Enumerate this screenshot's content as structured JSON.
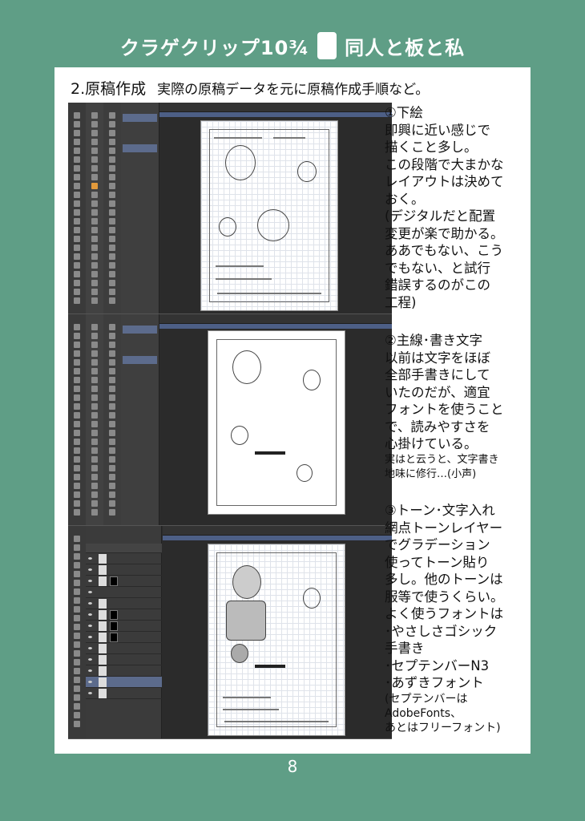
{
  "header": {
    "title_left": "クラゲクリップ10¾",
    "title_right": "同人と板と私",
    "icon": "tablet-icon"
  },
  "section": {
    "title": "2.原稿作成",
    "subtitle": "実際の原稿データを元に原稿作成手順など。"
  },
  "steps": [
    {
      "heading": "①下絵",
      "body": "即興に近い感じで\n描くこと多し。\nこの段階で大まかな\nレイアウトは決めて\nおく。\n(デジタルだと配置\n変更が楽で助かる。\nああでもない、こう\nでもない、と試行\n錯誤するのがこの\n工程)"
    },
    {
      "heading": "②主線･書き文字",
      "body": "以前は文字をほぼ\n全部手書きにして\nいたのだが、適宜\nフォントを使うこと\nで、読みやすさを\n心掛けている。",
      "aside": "実はと云うと、文字書き\n地味に修行…(小声)"
    },
    {
      "heading": "③トーン･文字入れ",
      "body": "網点トーンレイヤー\nでグラデーション\n使ってトーン貼り\n多し。他のトーンは\n服等で使うくらい。\nよく使うフォントは\n･やさしさゴシック\n手書き\n･セプテンバーN3\n･あずきフォント",
      "aside": "(セプテンバーは\nAdobeFonts、\nあとはフリーフォント)"
    }
  ],
  "page_number": "8",
  "colors": {
    "background": "#5f9e86",
    "ui_dark": "#2b2b2b",
    "ui_highlight": "#5c6b8c"
  }
}
